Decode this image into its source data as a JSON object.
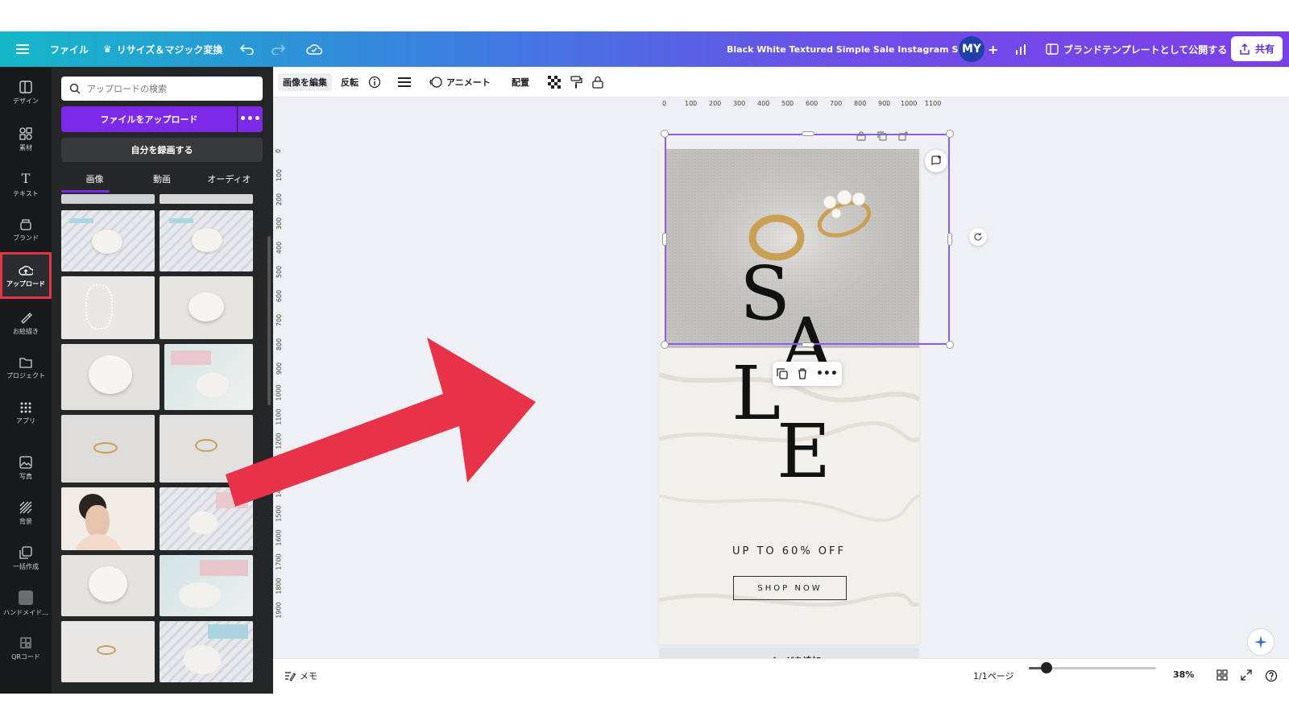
{
  "topbar": {
    "file_menu": "ファイル",
    "resize": "リサイズ＆マジック変換",
    "doc_title": "Black White Textured Simple Sale Instagram Story",
    "avatar_initials": "MY",
    "publish_template": "ブランドテンプレートとして公開する",
    "share": "共有"
  },
  "rail": [
    {
      "label": "デザイン",
      "icon": "layout-icon"
    },
    {
      "label": "素材",
      "icon": "elements-icon"
    },
    {
      "label": "テキスト",
      "icon": "text-icon"
    },
    {
      "label": "ブランド",
      "icon": "brand-icon"
    },
    {
      "label": "アップロード",
      "icon": "upload-cloud-icon",
      "active": true
    },
    {
      "label": "お絵描き",
      "icon": "draw-icon"
    },
    {
      "label": "プロジェクト",
      "icon": "folder-icon"
    },
    {
      "label": "アプリ",
      "icon": "apps-grid-icon"
    },
    {
      "label": "写真",
      "icon": "photo-icon"
    },
    {
      "label": "背景",
      "icon": "background-icon"
    },
    {
      "label": "一括作成",
      "icon": "bulk-create-icon"
    },
    {
      "label": "ハンドメイド...",
      "icon": "handmade-icon"
    },
    {
      "label": "QRコード",
      "icon": "qr-code-icon"
    }
  ],
  "panel": {
    "search_placeholder": "アップロードの検索",
    "upload_button": "ファイルをアップロード",
    "more": "•••",
    "record_button": "自分を録画する",
    "tabs": [
      "画像",
      "動画",
      "オーディオ"
    ]
  },
  "toolbar": {
    "edit_image": "画像を編集",
    "flip": "反転",
    "animate": "アニメート",
    "position": "配置"
  },
  "ruler": {
    "h_ticks": [
      "0",
      "100",
      "200",
      "300",
      "400",
      "500",
      "600",
      "700",
      "800",
      "900",
      "1000",
      "1100"
    ],
    "v_ticks": [
      "0",
      "100",
      "200",
      "300",
      "400",
      "500",
      "600",
      "700",
      "800",
      "900",
      "1000",
      "1100",
      "1200",
      "1300",
      "1400",
      "1500",
      "1600",
      "1700",
      "1800",
      "1900"
    ]
  },
  "canvas": {
    "sale_letters": [
      "S",
      "A",
      "L",
      "E"
    ],
    "offer_text": "UP TO 60% OFF",
    "shop_button": "SHOP NOW",
    "add_page": "+ ページを追加"
  },
  "bottombar": {
    "notes": "メモ",
    "page_indicator": "1/1ページ",
    "zoom": "38%",
    "zoom_fraction": 0.38
  },
  "colors": {
    "accent": "#7d2ae8",
    "selection": "#8b5cf6",
    "highlight_red": "#e8324a"
  }
}
